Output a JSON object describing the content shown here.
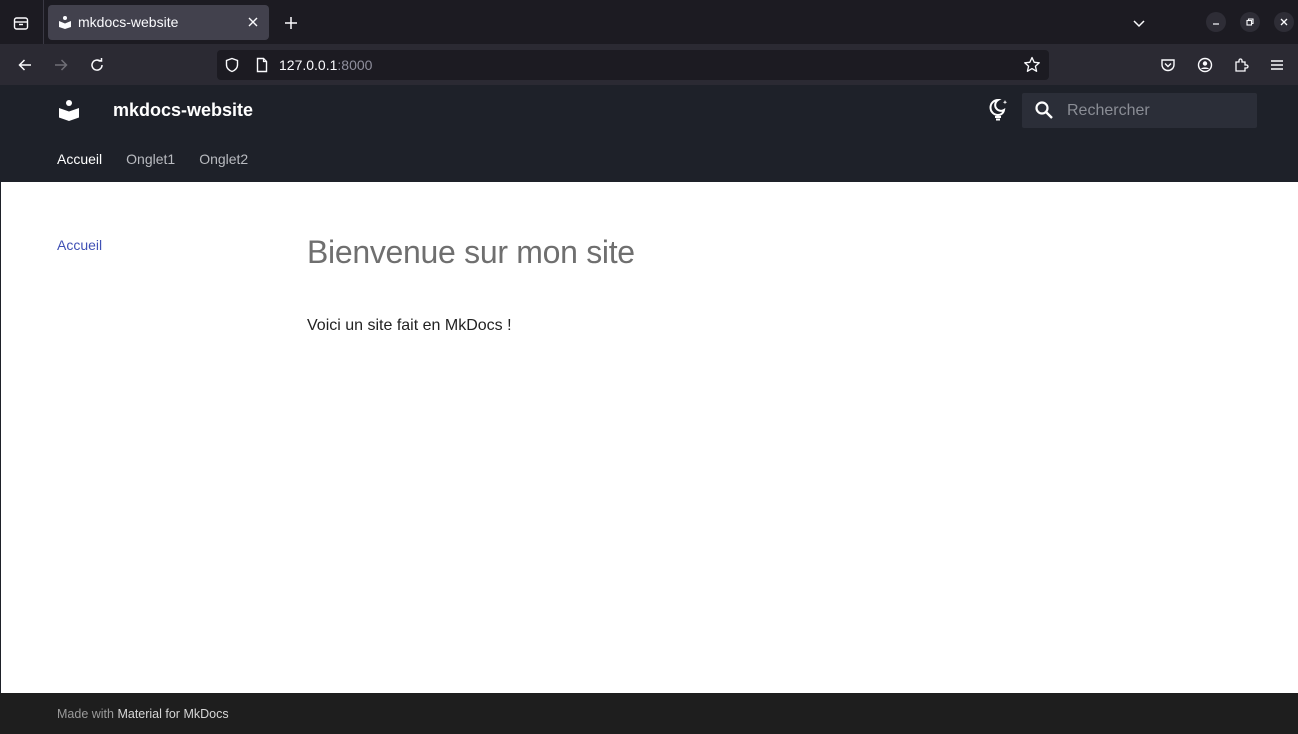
{
  "browser": {
    "tab": {
      "title": "mkdocs-website"
    },
    "url": {
      "host": "127.0.0.1",
      "port": ":8000"
    }
  },
  "site": {
    "name": "mkdocs-website",
    "search_placeholder": "Rechercher",
    "tabs": [
      {
        "label": "Accueil",
        "active": true
      },
      {
        "label": "Onglet1",
        "active": false
      },
      {
        "label": "Onglet2",
        "active": false
      }
    ]
  },
  "sidebar": {
    "items": [
      {
        "label": "Accueil"
      }
    ]
  },
  "content": {
    "heading": "Bienvenue sur mon site",
    "paragraph": "Voici un site fait en MkDocs !"
  },
  "footer": {
    "prefix": "Made with ",
    "link": "Material for MkDocs"
  },
  "colors": {
    "header_bg": "#1e2129",
    "accent_link": "#4051b5",
    "browser_bg": "#1c1b22"
  }
}
